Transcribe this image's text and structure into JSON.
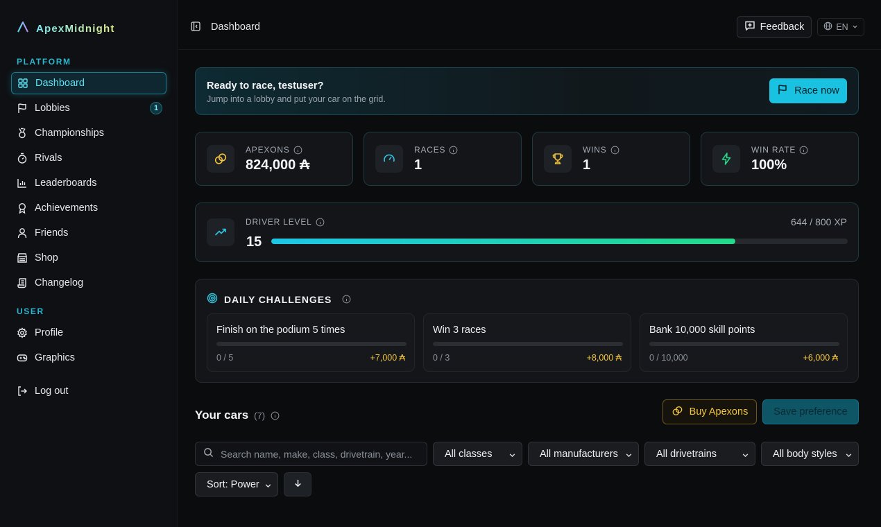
{
  "app": {
    "name": "ApexMidnight"
  },
  "colors": {
    "accent": "#19c2e0",
    "gold": "#f2c53d",
    "green": "#24d98a",
    "background": "#0b0c0e"
  },
  "sidebar": {
    "platform_label": "PLATFORM",
    "user_label": "USER",
    "items": [
      {
        "label": "Dashboard",
        "icon": "grid-icon"
      },
      {
        "label": "Lobbies",
        "icon": "flag-icon",
        "badge": "1"
      },
      {
        "label": "Championships",
        "icon": "medal-icon"
      },
      {
        "label": "Rivals",
        "icon": "stopwatch-icon"
      },
      {
        "label": "Leaderboards",
        "icon": "bar-chart-icon"
      },
      {
        "label": "Achievements",
        "icon": "award-icon"
      },
      {
        "label": "Friends",
        "icon": "user-icon"
      },
      {
        "label": "Shop",
        "icon": "store-icon"
      },
      {
        "label": "Changelog",
        "icon": "scroll-icon"
      }
    ],
    "user_items": [
      {
        "label": "Profile",
        "icon": "gear-icon"
      },
      {
        "label": "Graphics",
        "icon": "gamepad-icon"
      }
    ],
    "logout": {
      "label": "Log out",
      "icon": "logout-icon"
    }
  },
  "topbar": {
    "breadcrumb": "Dashboard",
    "feedback_label": "Feedback",
    "language": "EN"
  },
  "hero": {
    "title": "Ready to race, testuser?",
    "subtitle": "Jump into a lobby and put your car on the grid.",
    "cta": "Race now"
  },
  "stats": [
    {
      "label": "APEXONS",
      "value": "824,000 ₳",
      "icon": "coins-icon"
    },
    {
      "label": "RACES",
      "value": "1",
      "icon": "gauge-icon"
    },
    {
      "label": "WINS",
      "value": "1",
      "icon": "trophy-icon"
    },
    {
      "label": "WIN RATE",
      "value": "100%",
      "icon": "bolt-icon"
    }
  ],
  "level": {
    "label": "DRIVER LEVEL",
    "value": "15",
    "xp_text": "644 / 800 XP",
    "progress": 0.805,
    "icon": "trending-up-icon"
  },
  "daily": {
    "title": "DAILY CHALLENGES",
    "challenges": [
      {
        "name": "Finish on the podium 5 times",
        "progress": "0 / 5",
        "reward": "+7,000 ₳"
      },
      {
        "name": "Win 3 races",
        "progress": "0 / 3",
        "reward": "+8,000 ₳"
      },
      {
        "name": "Bank 10,000 skill points",
        "progress": "0 / 10,000",
        "reward": "+6,000 ₳"
      }
    ]
  },
  "cars": {
    "title": "Your cars",
    "count": "(7)",
    "buy_label": "Buy Apexons",
    "save_label": "Save preference",
    "search_placeholder": "Search name, make, class, drivetrain, year...",
    "filters": [
      "All classes",
      "All manufacturers",
      "All drivetrains",
      "All body styles"
    ],
    "sort": "Sort: Power"
  }
}
